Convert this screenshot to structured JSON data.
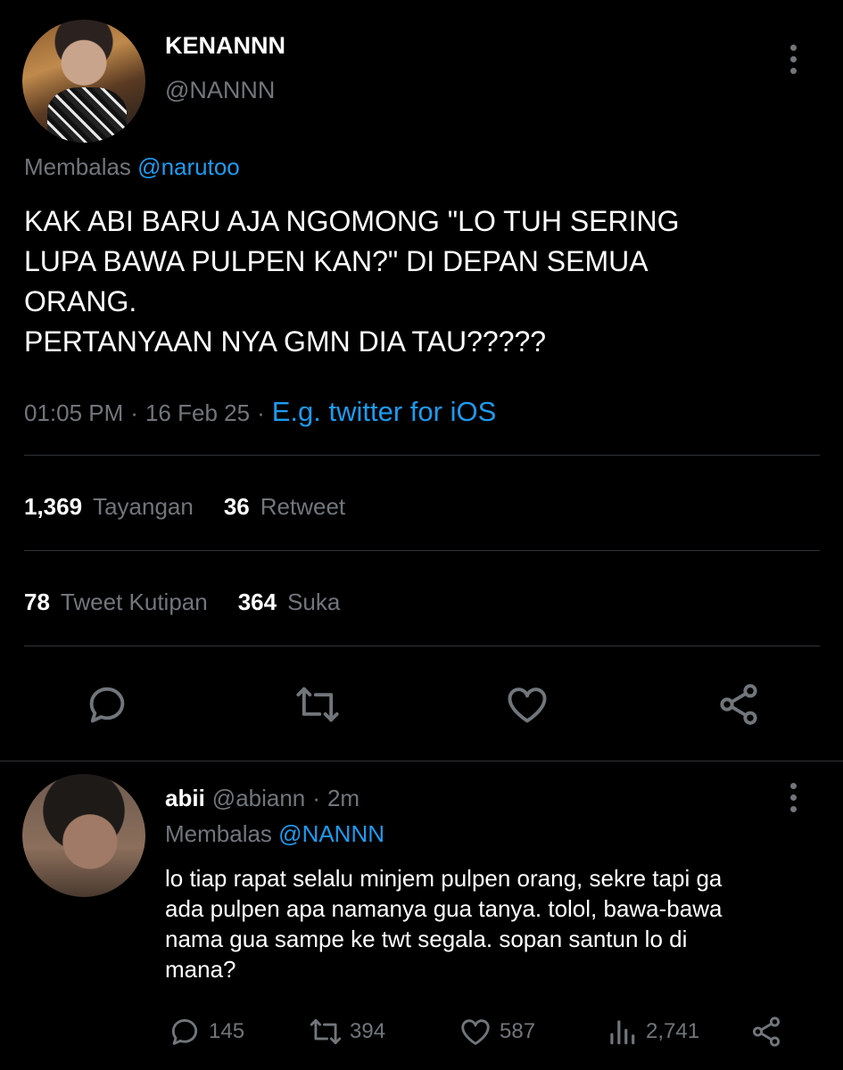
{
  "tweet": {
    "display_name": "KENANNN",
    "handle": "@NANNN",
    "replying_prefix": "Membalas",
    "replying_to": "@narutoo",
    "text": "KAK ABI BARU AJA NGOMONG \"LO TUH SERING\nLUPA BAWA PULPEN KAN?\" DI DEPAN SEMUA\nORANG.\nPERTANYAAN NYA GMN DIA TAU?????",
    "time": "01:05 PM",
    "date": "16 Feb 25",
    "source": "E.g. twitter for iOS",
    "stats": {
      "views_count": "1,369",
      "views_label": "Tayangan",
      "retweets_count": "36",
      "retweets_label": "Retweet",
      "quotes_count": "78",
      "quotes_label": "Tweet Kutipan",
      "likes_count": "364",
      "likes_label": "Suka"
    },
    "actions": [
      "reply-icon",
      "retweet-icon",
      "like-icon",
      "share-icon"
    ]
  },
  "reply": {
    "display_name": "abii",
    "handle": "@abiann",
    "separator": "·",
    "age": "2m",
    "replying_prefix": "Membalas",
    "replying_to": "@NANNN",
    "text": "lo tiap rapat selalu minjem pulpen orang, sekre tapi ga\nada pulpen apa namanya gua tanya. tolol, bawa-bawa\nnama gua sampe ke twt segala. sopan santun lo di\nmana?",
    "counts": {
      "replies": "145",
      "retweets": "394",
      "likes": "587",
      "views": "2,741"
    }
  },
  "colors": {
    "background": "#000000",
    "accent": "#1d9bf0",
    "muted": "#71767b",
    "text": "#e7e9ea",
    "divider": "#2f3336"
  }
}
